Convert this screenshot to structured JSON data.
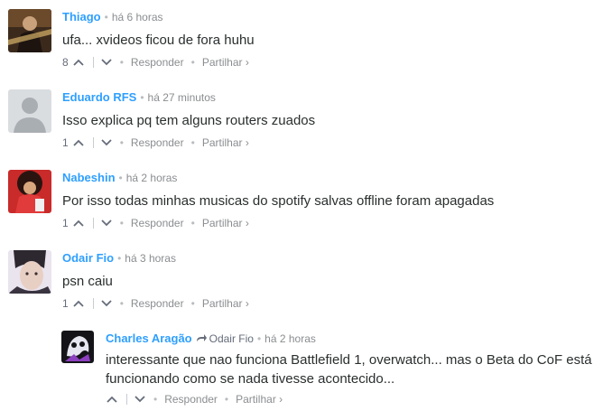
{
  "actions": {
    "reply_label": "Responder",
    "share_label": "Partilhar ›"
  },
  "comments": [
    {
      "author": "Thiago",
      "time": "há 6 horas",
      "text": "ufa... xvideos ficou de fora huhu",
      "votes": "8"
    },
    {
      "author": "Eduardo RFS",
      "time": "há 27 minutos",
      "text": "Isso explica pq tem alguns routers zuados",
      "votes": "1"
    },
    {
      "author": "Nabeshin",
      "time": "há 2 horas",
      "text": "Por isso todas minhas musicas do spotify salvas offline foram apagadas",
      "votes": "1"
    },
    {
      "author": "Odair Fio",
      "time": "há 3 horas",
      "text": "psn caiu",
      "votes": "1"
    },
    {
      "author": "Charles Aragão",
      "reply_to": "Odair Fio",
      "time": "há 2 horas",
      "text": "interessante que nao funciona Battlefield 1, overwatch... mas o Beta do CoF está funcionando como se nada tivesse acontecido...",
      "votes": ""
    }
  ],
  "colors": {
    "author": "#2e9fff",
    "meta": "#8a8d90",
    "text": "#2a2e2e"
  },
  "icons": {
    "upvote": "chevron-up-icon",
    "downvote": "chevron-down-icon",
    "reply_arrow": "reply-arrow-icon"
  }
}
